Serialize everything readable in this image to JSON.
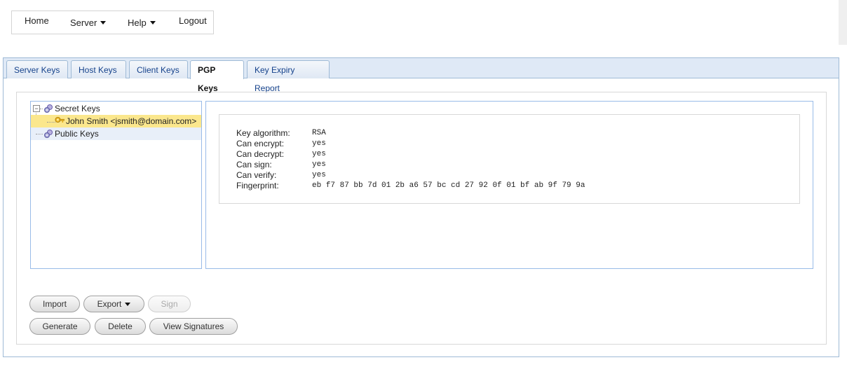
{
  "menu": {
    "home": "Home",
    "server": "Server",
    "help": "Help",
    "logout": "Logout"
  },
  "tabs": [
    {
      "label": "Server Keys"
    },
    {
      "label": "Host Keys"
    },
    {
      "label": "Client Keys"
    },
    {
      "label": "PGP Keys",
      "active": true
    },
    {
      "label": "Key Expiry Report"
    }
  ],
  "tree": {
    "secret_keys": "Secret Keys",
    "selected_key": "John Smith <jsmith@domain.com>",
    "public_keys": "Public Keys"
  },
  "details": {
    "rows": [
      {
        "label": "Key algorithm:",
        "value": "RSA"
      },
      {
        "label": "Can encrypt:",
        "value": "yes"
      },
      {
        "label": "Can decrypt:",
        "value": "yes"
      },
      {
        "label": "Can sign:",
        "value": "yes"
      },
      {
        "label": "Can verify:",
        "value": "yes"
      },
      {
        "label": "Fingerprint:",
        "value": "eb f7 87 bb 7d 01 2b a6 57 bc cd 27 92 0f 01 bf ab 9f 79 9a"
      }
    ]
  },
  "buttons": {
    "import": "Import",
    "export": "Export",
    "sign": "Sign",
    "generate": "Generate",
    "delete": "Delete",
    "view_signatures": "View Signatures"
  },
  "colors": {
    "tab_bar": "#dfe9f6",
    "border_blue": "#99bbe8",
    "selection": "#fbe78d"
  }
}
